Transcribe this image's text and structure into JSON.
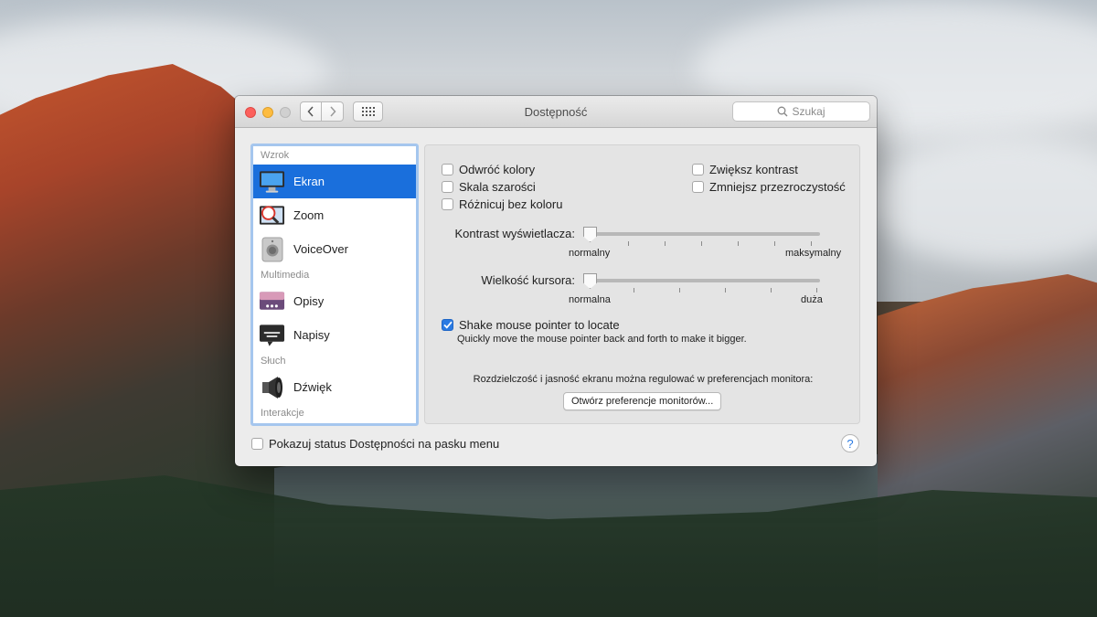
{
  "window": {
    "title": "Dostępność",
    "search_placeholder": "Szukaj"
  },
  "sidebar": {
    "sections": {
      "vision": "Wzrok",
      "media": "Multimedia",
      "hearing": "Słuch",
      "interaction": "Interakcje"
    },
    "items": [
      {
        "label": "Ekran",
        "icon": "display-icon",
        "selected": true
      },
      {
        "label": "Zoom",
        "icon": "zoom-icon",
        "selected": false
      },
      {
        "label": "VoiceOver",
        "icon": "voiceover-icon",
        "selected": false
      },
      {
        "label": "Opisy",
        "icon": "descriptions-icon",
        "selected": false
      },
      {
        "label": "Napisy",
        "icon": "captions-icon",
        "selected": false
      },
      {
        "label": "Dźwięk",
        "icon": "speaker-icon",
        "selected": false
      }
    ]
  },
  "display": {
    "invert_colors": {
      "label": "Odwróć kolory",
      "checked": false
    },
    "grayscale": {
      "label": "Skala szarości",
      "checked": false
    },
    "differentiate": {
      "label": "Różnicuj bez koloru",
      "checked": false
    },
    "increase_contrast": {
      "label": "Zwiększ kontrast",
      "checked": false
    },
    "reduce_transparency": {
      "label": "Zmniejsz przezroczystość",
      "checked": false
    },
    "contrast_slider": {
      "label": "Kontrast wyświetlacza:",
      "min_label": "normalny",
      "max_label": "maksymalny",
      "value": 0
    },
    "cursor_slider": {
      "label": "Wielkość kursora:",
      "min_label": "normalna",
      "max_label": "duża",
      "value": 0
    },
    "shake": {
      "label": "Shake mouse pointer to locate",
      "description": "Quickly move the mouse pointer back and forth to make it bigger.",
      "checked": true
    },
    "monitor_note": "Rozdzielczość i jasność ekranu można regulować w preferencjach monitora:",
    "monitor_button": "Otwórz preferencje monitorów..."
  },
  "footer": {
    "show_status_label": "Pokazuj status Dostępności na pasku menu",
    "show_status_checked": false,
    "help_label": "?"
  },
  "colors": {
    "selection": "#1a6fdc",
    "checkbox_checked": "#2a7ae2",
    "close": "#fc605c",
    "minimize": "#fdbc40"
  }
}
